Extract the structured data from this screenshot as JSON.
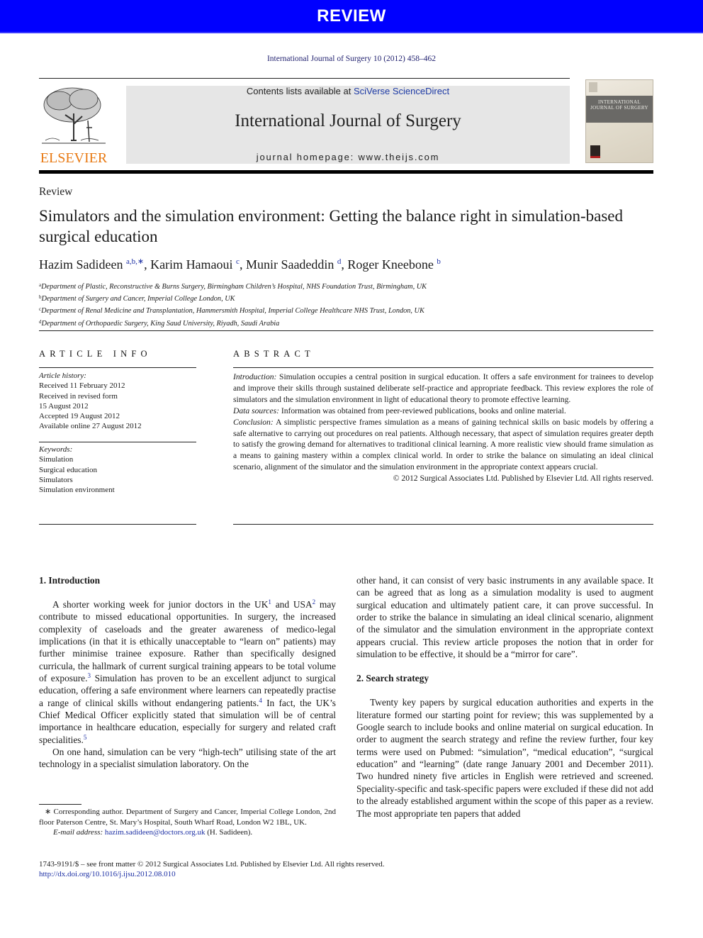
{
  "banner": {
    "label": "REVIEW",
    "color": "#0000ff"
  },
  "journal": {
    "citation": "International Journal of Surgery 10 (2012) 458–462",
    "publisher_logo": "ELSEVIER",
    "contents_prefix": "Contents lists available at ",
    "contents_link": "SciVerse ScienceDirect",
    "title": "International Journal of Surgery",
    "homepage_prefix": "journal homepage: ",
    "homepage_url": "www.theijs.com",
    "cover_title": "INTERNATIONAL JOURNAL OF SURGERY"
  },
  "article": {
    "section_type": "Review",
    "title": "Simulators and the simulation environment: Getting the balance right in simulation-based surgical education",
    "authors": [
      {
        "name": "Hazim Sadideen",
        "marks": "a,b,∗"
      },
      {
        "name": "Karim Hamaoui",
        "marks": "c"
      },
      {
        "name": "Munir Saadeddin",
        "marks": "d"
      },
      {
        "name": "Roger Kneebone",
        "marks": "b"
      }
    ],
    "affiliations": [
      {
        "mark": "a",
        "text": "Department of Plastic, Reconstructive & Burns Surgery, Birmingham Children’s Hospital, NHS Foundation Trust, Birmingham, UK"
      },
      {
        "mark": "b",
        "text": "Department of Surgery and Cancer, Imperial College London, UK"
      },
      {
        "mark": "c",
        "text": "Department of Renal Medicine and Transplantation, Hammersmith Hospital, Imperial College Healthcare NHS Trust, London, UK"
      },
      {
        "mark": "d",
        "text": "Department of Orthopaedic Surgery, King Saud University, Riyadh, Saudi Arabia"
      }
    ]
  },
  "article_info": {
    "heading": "ARTICLE INFO",
    "history_label": "Article history:",
    "history": [
      "Received 11 February 2012",
      "Received in revised form",
      "15 August 2012",
      "Accepted 19 August 2012",
      "Available online 27 August 2012"
    ],
    "keywords_label": "Keywords:",
    "keywords": [
      "Simulation",
      "Surgical education",
      "Simulators",
      "Simulation environment"
    ]
  },
  "abstract": {
    "heading": "ABSTRACT",
    "introduction_label": "Introduction:",
    "introduction": " Simulation occupies a central position in surgical education. It offers a safe environment for trainees to develop and improve their skills through sustained deliberate self-practice and appropriate feedback. This review explores the role of simulators and the simulation environment in light of educational theory to promote effective learning.",
    "data_sources_label": "Data sources:",
    "data_sources": " Information was obtained from peer-reviewed publications, books and online material.",
    "conclusion_label": "Conclusion:",
    "conclusion": " A simplistic perspective frames simulation as a means of gaining technical skills on basic models by offering a safe alternative to carrying out procedures on real patients. Although necessary, that aspect of simulation requires greater depth to satisfy the growing demand for alternatives to traditional clinical learning. A more realistic view should frame simulation as a means to gaining mastery within a complex clinical world. In order to strike the balance on simulating an ideal clinical scenario, alignment of the simulator and the simulation environment in the appropriate context appears crucial.",
    "copyright": "© 2012 Surgical Associates Ltd. Published by Elsevier Ltd. All rights reserved."
  },
  "body": {
    "section1_heading": "1.  Introduction",
    "p1_a": "A shorter working week for junior doctors in the UK",
    "p1_ref1": "1",
    "p1_b": " and USA",
    "p1_ref2": "2",
    "p1_c": " may contribute to missed educational opportunities. In surgery, the increased complexity of caseloads and the greater awareness of medico-legal implications (in that it is ethically unacceptable to “learn on” patients) may further minimise trainee exposure. Rather than specifically designed curricula, the hallmark of current surgical training appears to be total volume of exposure.",
    "p1_ref3": "3",
    "p1_d": " Simulation has proven to be an excellent adjunct to surgical education, offering a safe environment where learners can repeatedly practise a range of clinical skills without endangering patients.",
    "p1_ref4": "4",
    "p1_e": " In fact, the UK’s Chief Medical Officer explicitly stated that simulation will be of central importance in healthcare education, especially for surgery and related craft specialities.",
    "p1_ref5": "5",
    "p2": "On one hand, simulation can be very “high-tech” utilising state of the art technology in a specialist simulation laboratory. On the other hand, it can consist of very basic instruments in any available space. It can be agreed that as long as a simulation modality is used to augment surgical education and ultimately patient care, it can prove successful. In order to strike the balance in simulating an ideal clinical scenario, alignment of the simulator and the simulation environment in the appropriate context appears crucial. This review article proposes the notion that in order for simulation to be effective, it should be a “mirror for care”.",
    "p2_left": "On one hand, simulation can be very “high-tech” utilising state of the art technology in a specialist simulation laboratory. On the",
    "p2_right": "other hand, it can consist of very basic instruments in any available space. It can be agreed that as long as a simulation modality is used to augment surgical education and ultimately patient care, it can prove successful. In order to strike the balance in simulating an ideal clinical scenario, alignment of the simulator and the simulation environment in the appropriate context appears crucial. This review article proposes the notion that in order for simulation to be effective, it should be a “mirror for care”.",
    "section2_heading": "2.  Search strategy",
    "p3": "Twenty key papers by surgical education authorities and experts in the literature formed our starting point for review; this was supplemented by a Google search to include books and online material on surgical education. In order to augment the search strategy and refine the review further, four key terms were used on Pubmed: “simulation”, “medical education”, “surgical education” and “learning” (date range January 2001 and December 2011). Two hundred ninety five articles in English were retrieved and screened. Speciality-specific and task-specific papers were excluded if these did not add to the already established argument within the scope of this paper as a review. The most appropriate ten papers that added"
  },
  "footnote": {
    "corresponding": "∗ Corresponding author. Department of Surgery and Cancer, Imperial College London, 2nd floor Paterson Centre, St. Mary’s Hospital, South Wharf Road, London W2 1BL, UK.",
    "email_label": "E-mail address:",
    "email": "hazim.sadideen@doctors.org.uk",
    "email_suffix": " (H. Sadideen)."
  },
  "front_matter": {
    "issn_line": "1743-9191/$ – see front matter © 2012 Surgical Associates Ltd. Published by Elsevier Ltd. All rights reserved.",
    "doi": "http://dx.doi.org/10.1016/j.ijsu.2012.08.010"
  }
}
